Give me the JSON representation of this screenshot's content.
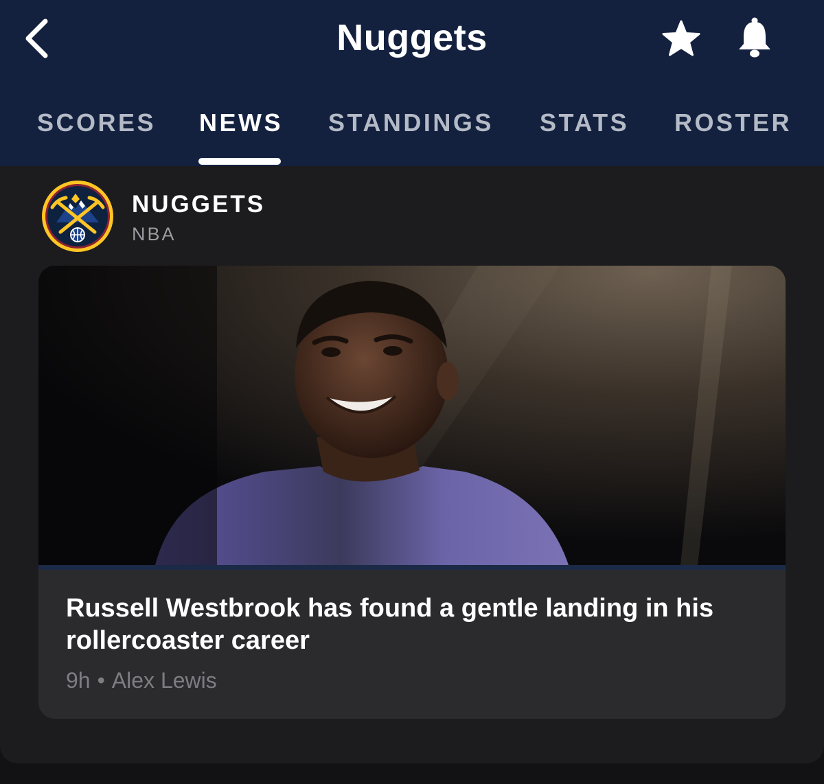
{
  "header": {
    "title": "Nuggets",
    "back_icon": "chevron-left-icon",
    "favorite_icon": "star-icon",
    "notifications_icon": "bell-icon",
    "background_color": "#13213f"
  },
  "tabs": [
    {
      "label": "SCORES",
      "active": false
    },
    {
      "label": "NEWS",
      "active": true
    },
    {
      "label": "STANDINGS",
      "active": false
    },
    {
      "label": "STATS",
      "active": false
    },
    {
      "label": "ROSTER",
      "active": false
    }
  ],
  "feed": {
    "source": {
      "team": "NUGGETS",
      "league": "NBA",
      "logo_icon": "denver-nuggets-logo",
      "logo_colors": {
        "navy": "#0e2240",
        "gold": "#fec524",
        "red": "#8b2131",
        "blue": "#1d428a"
      }
    },
    "article": {
      "image_subject": "player-photo",
      "headline": "Russell Westbrook has found a gentle landing in his rollercoaster career",
      "age": "9h",
      "separator": "•",
      "author": "Alex Lewis"
    }
  }
}
